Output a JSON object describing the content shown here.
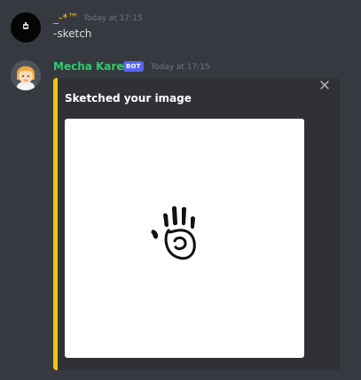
{
  "messages": [
    {
      "author": "_-*™",
      "author_color": "#f1c40f",
      "timestamp": "Today at 17:15",
      "avatar_icon": "dark-avatar-icon",
      "content": "-sketch"
    },
    {
      "author": "Mecha Karen",
      "author_color": "#2ecc71",
      "bot_tag": "BOT",
      "timestamp": "Today at 17:15",
      "avatar_icon": "cartoon-girl-avatar-icon",
      "embed": {
        "title": "Sketched your image",
        "accent_color": "#f1c40f",
        "close_icon": "close-icon",
        "image_icon": "sketched-hand-image"
      }
    }
  ],
  "colors": {
    "background": "#36393f",
    "embed_background": "#2f3136",
    "bot_tag": "#5865f2",
    "timestamp": "#72767d",
    "text": "#dcddde"
  }
}
